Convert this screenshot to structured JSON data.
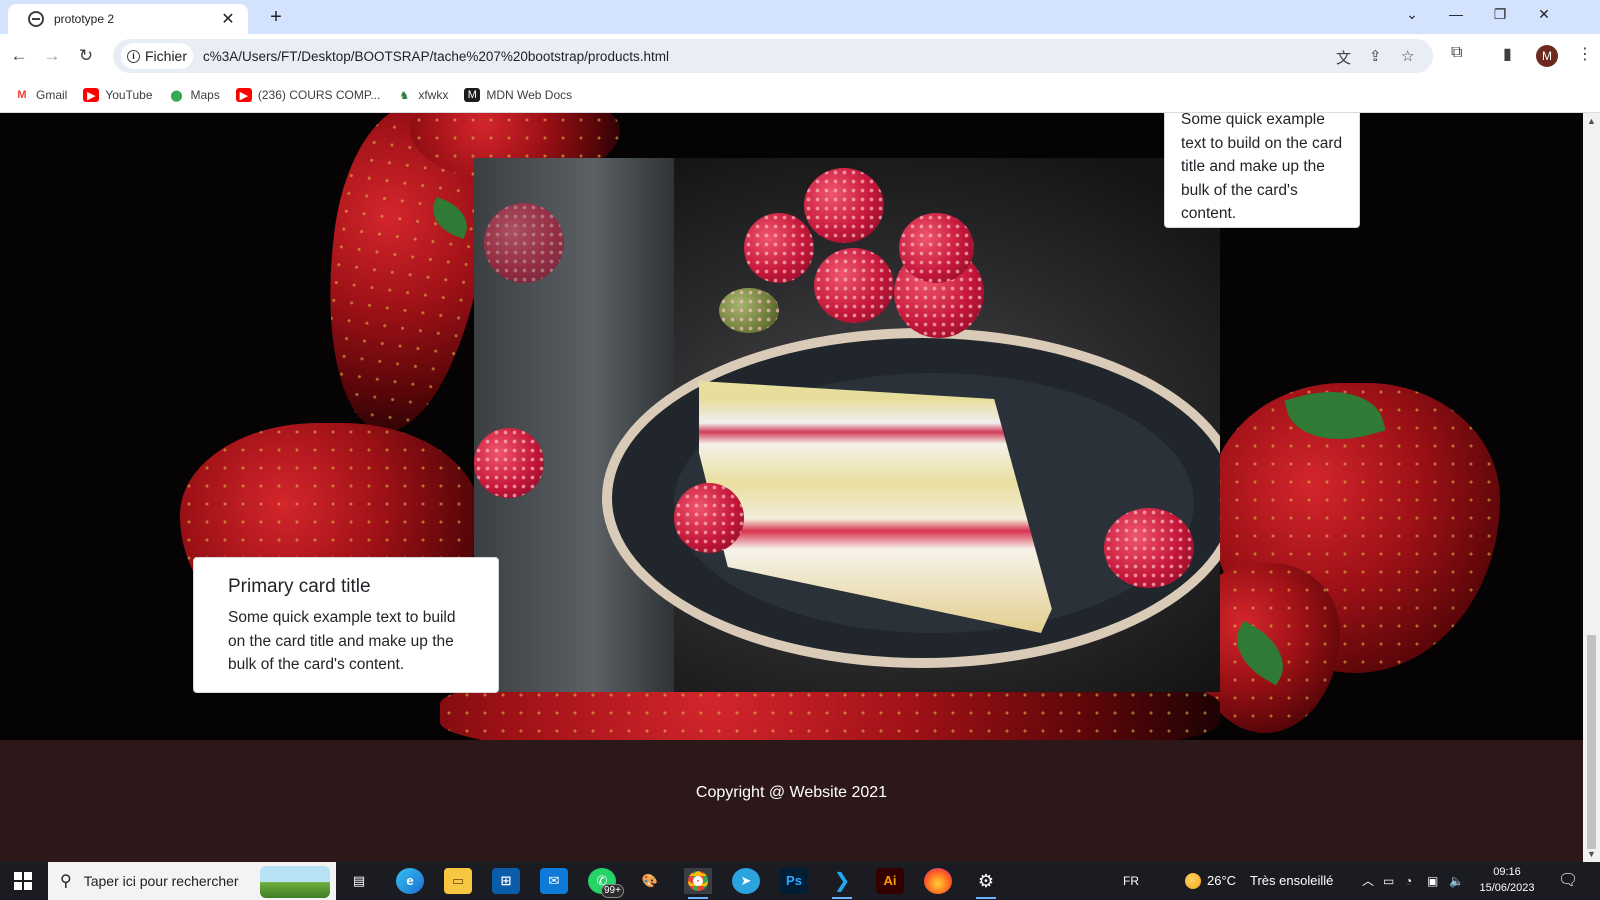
{
  "browser": {
    "tab_title": "prototype 2",
    "tab_close": "✕",
    "new_tab": "+",
    "url_chip": "Fichier",
    "url": "c%3A/Users/FT/Desktop/BOOTSRAP/tache%207%20bootstrap/products.html",
    "profile_initial": "M",
    "bookmarks": [
      {
        "label": "Gmail",
        "icon": "gmail-icon",
        "color": "#ea4335"
      },
      {
        "label": "YouTube",
        "icon": "youtube-icon",
        "color": "#ff0000"
      },
      {
        "label": "Maps",
        "icon": "maps-icon",
        "color": "#34a853"
      },
      {
        "label": "(236) COURS COMP...",
        "icon": "youtube-icon",
        "color": "#ff0000"
      },
      {
        "label": "xfwkx",
        "icon": "xfwkx-icon",
        "color": "#2e7d32"
      },
      {
        "label": "MDN Web Docs",
        "icon": "mdn-icon",
        "color": "#1b1b1b"
      }
    ]
  },
  "page": {
    "card_top_text": "Some quick example text to build on the card title and make up the bulk of the card's content.",
    "card_bottom_title": "Primary card title",
    "card_bottom_text": "Some quick example text to build on the card title and make up the bulk of the card's content.",
    "footer_text": "Copyright @ Website 2021"
  },
  "taskbar": {
    "search_placeholder": "Taper ici pour rechercher",
    "whatsapp_badge": "99+",
    "apps": [
      "task-view",
      "edge",
      "file-explorer",
      "microsoft-store",
      "mail",
      "whatsapp",
      "paint",
      "chrome",
      "telegram",
      "photoshop",
      "vscode",
      "illustrator",
      "firefox",
      "settings"
    ],
    "language": "FR",
    "weather_temp": "26°C",
    "weather_desc": "Très ensoleillé",
    "time": "09:16",
    "date": "15/06/2023"
  },
  "colors": {
    "hero_bg": "#060304",
    "footer_bg": "#2c1719",
    "tabstrip": "#d3e3fd"
  }
}
